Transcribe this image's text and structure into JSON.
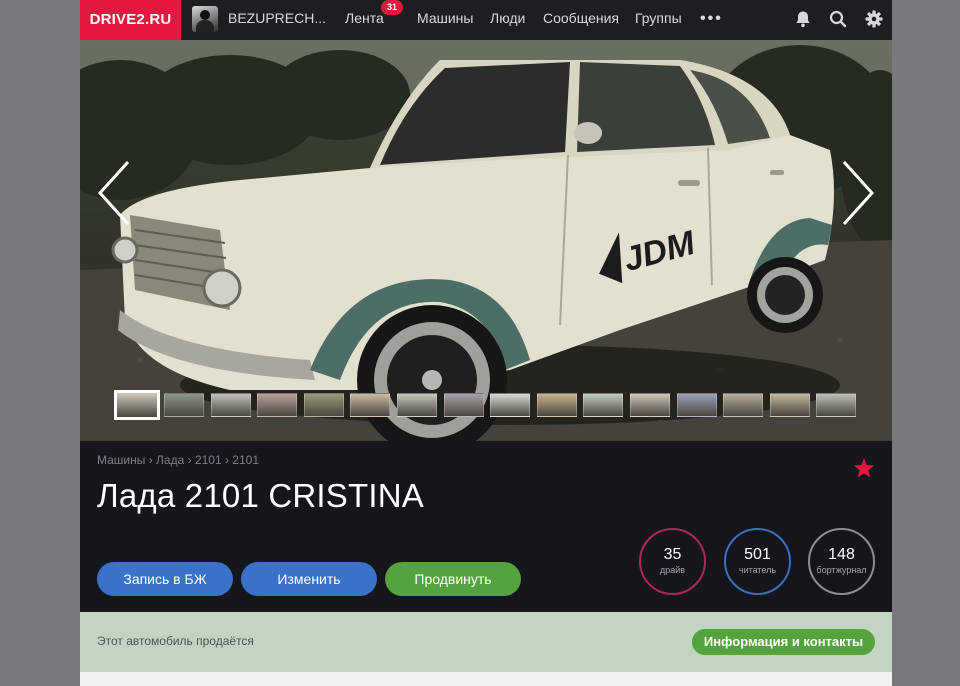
{
  "topbar": {
    "logo": "DRIVE2.RU",
    "username": "BEZUPRECH...",
    "nav": [
      {
        "label": "Лента"
      },
      {
        "label": "Машины"
      },
      {
        "label": "Люди"
      },
      {
        "label": "Сообщения"
      },
      {
        "label": "Группы"
      }
    ],
    "feed_badge": "31",
    "more": "•••",
    "icons": [
      "bell-icon",
      "search-icon",
      "gear-icon"
    ]
  },
  "gallery": {
    "decal_text": "JDM",
    "thumbnail_count": 16,
    "active_thumbnail": 0,
    "icons": [
      "chevron-left-icon",
      "chevron-right-icon"
    ]
  },
  "car": {
    "breadcrumb": "Машины › Лада › 2101 › 2101",
    "title": "Лада 2101 CRISTINA",
    "favorite_icon": "star-icon",
    "accent_color": "#e5173f"
  },
  "actions": {
    "logbook": "Запись в БЖ",
    "edit": "Изменить",
    "promote": "Продвинуть"
  },
  "stats": [
    {
      "value": "35",
      "label": "драйв",
      "color": "#b02757"
    },
    {
      "value": "501",
      "label": "читатель",
      "color": "#3c6fc0"
    },
    {
      "value": "148",
      "label": "бортжурнал",
      "color": "#8c8e92"
    }
  ],
  "sale": {
    "text": "Этот автомобиль продаётся",
    "button": "Информация и контакты"
  }
}
